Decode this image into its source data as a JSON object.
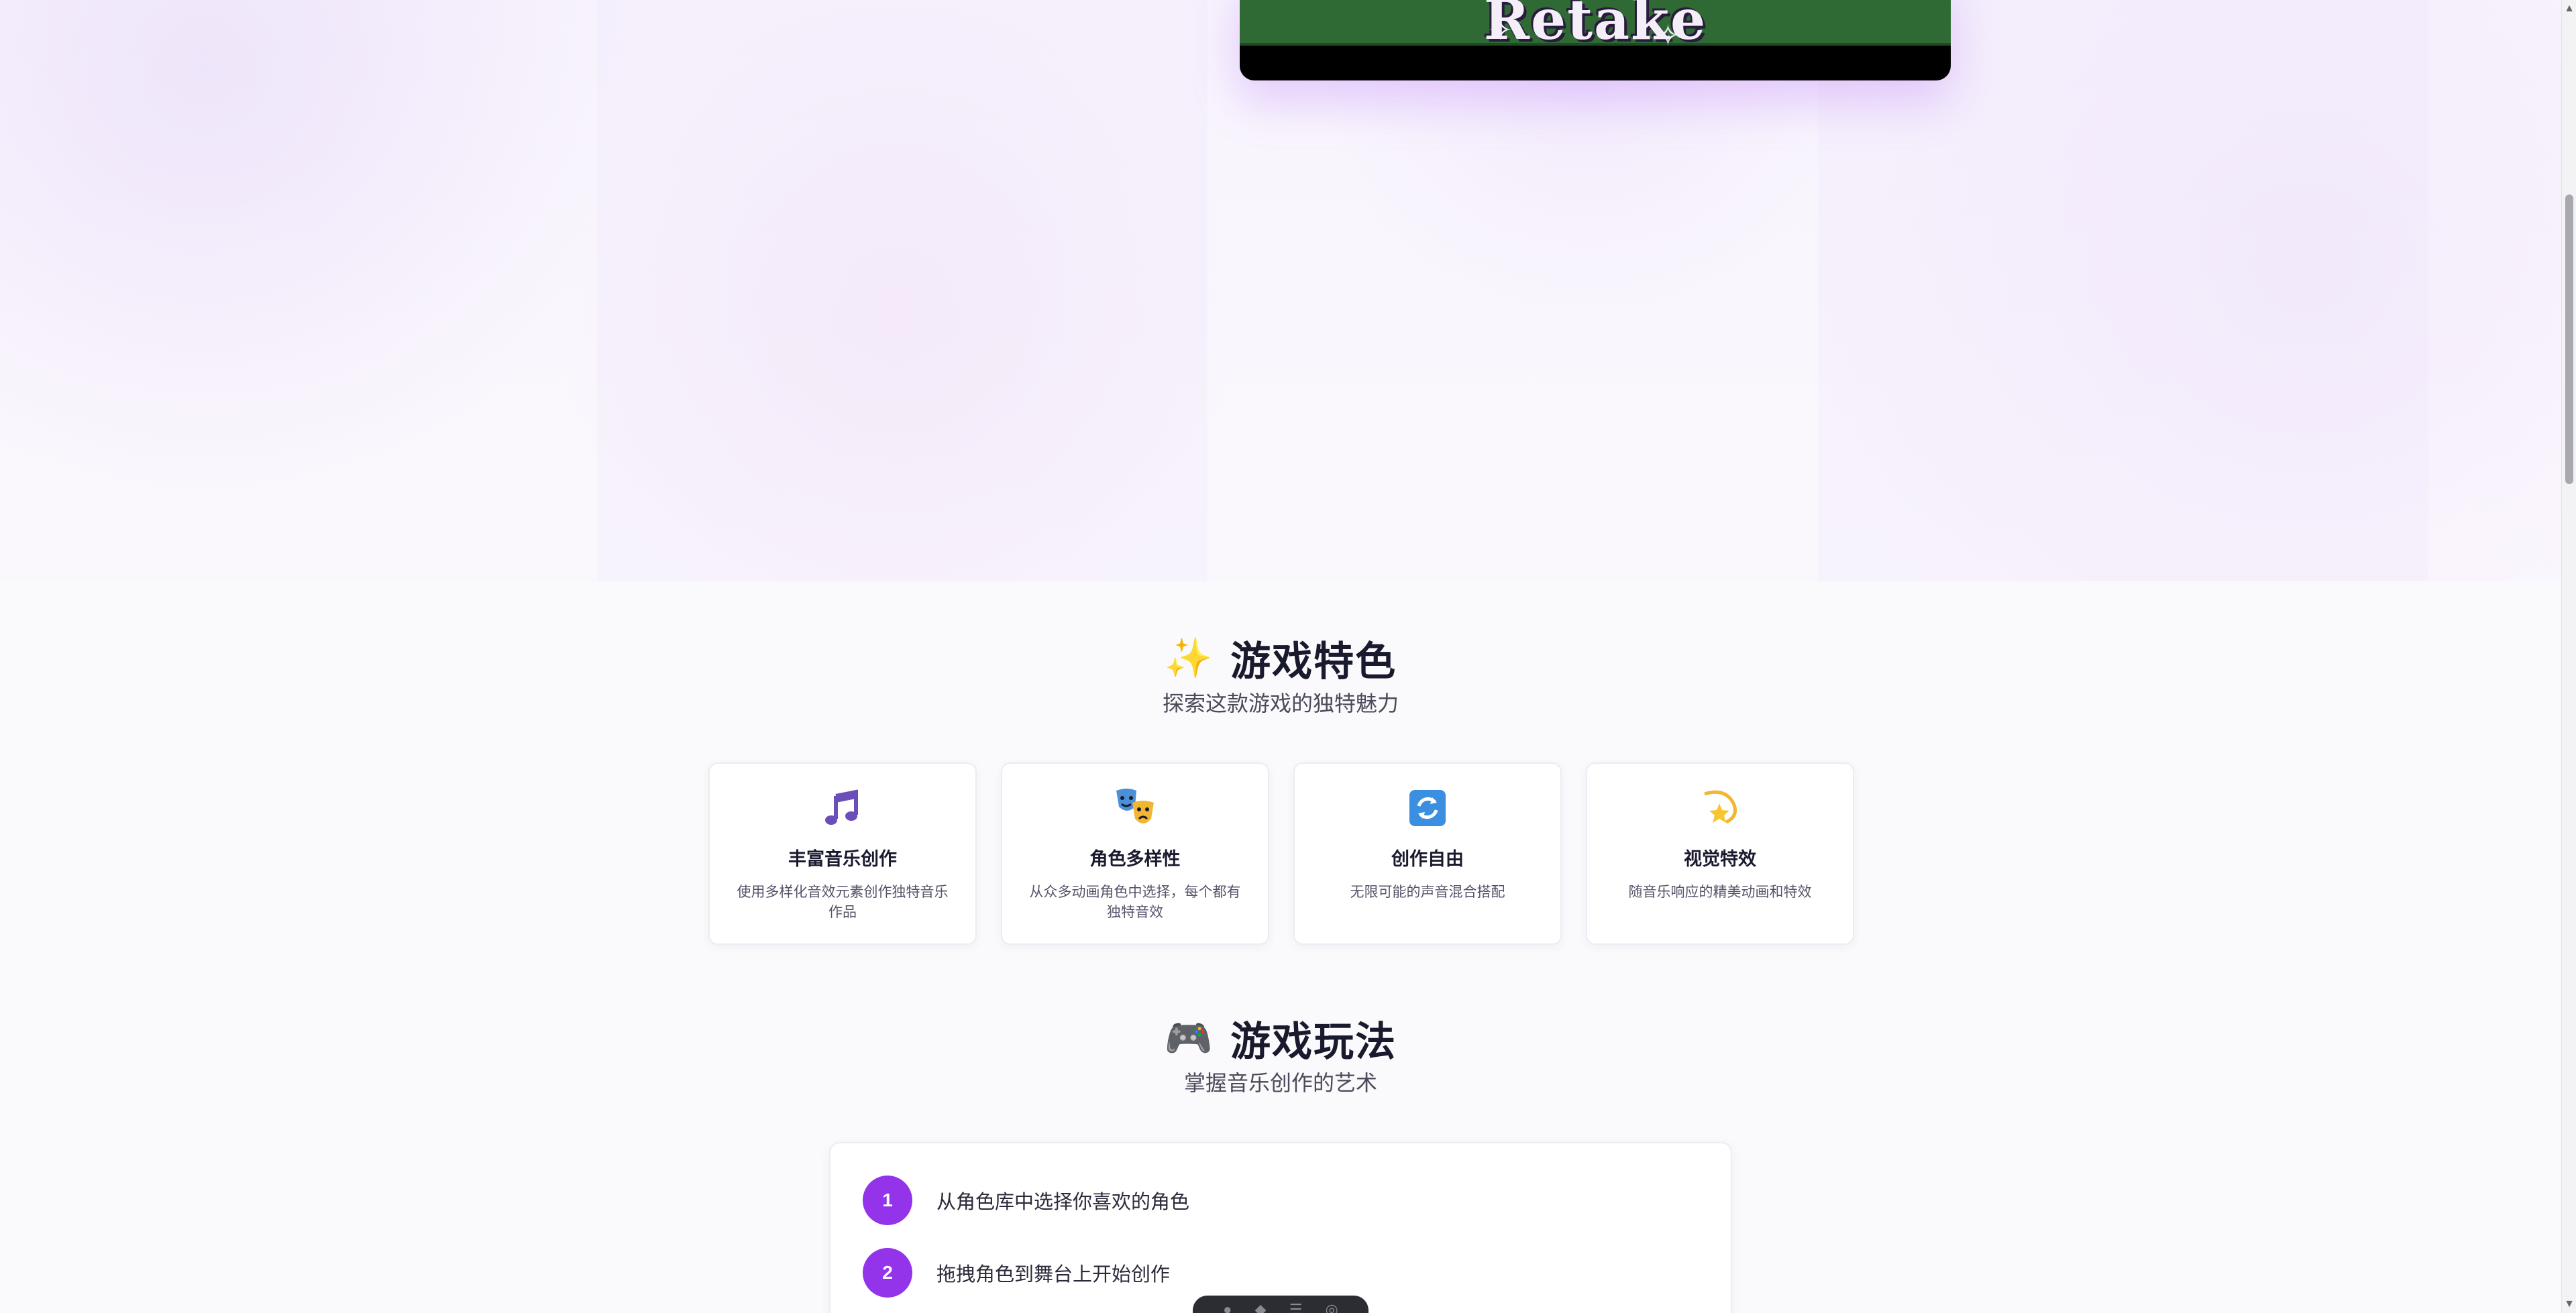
{
  "hero": {
    "logo_text": "Retake"
  },
  "features_section": {
    "emoji": "✨",
    "title": "游戏特色",
    "subtitle": "探索这款游戏的独特魅力",
    "cards": [
      {
        "icon": "music-notes-icon",
        "title": "丰富音乐创作",
        "desc": "使用多样化音效元素创作独特音乐作品"
      },
      {
        "icon": "theater-masks-icon",
        "title": "角色多样性",
        "desc": "从众多动画角色中选择，每个都有独特音效"
      },
      {
        "icon": "repeat-arrows-icon",
        "title": "创作自由",
        "desc": "无限可能的声音混合搭配"
      },
      {
        "icon": "dizzy-star-icon",
        "title": "视觉特效",
        "desc": "随音乐响应的精美动画和特效"
      }
    ]
  },
  "gameplay_section": {
    "emoji": "🎮",
    "title": "游戏玩法",
    "subtitle": "掌握音乐创作的艺术",
    "steps": [
      {
        "number": "1",
        "label": "从角色库中选择你喜欢的角色"
      },
      {
        "number": "2",
        "label": "拖拽角色到舞台上开始创作"
      }
    ]
  },
  "colors": {
    "accent": "#9333ea",
    "hero_bg": "#f8f4fd",
    "video_green": "#2f6a35"
  }
}
